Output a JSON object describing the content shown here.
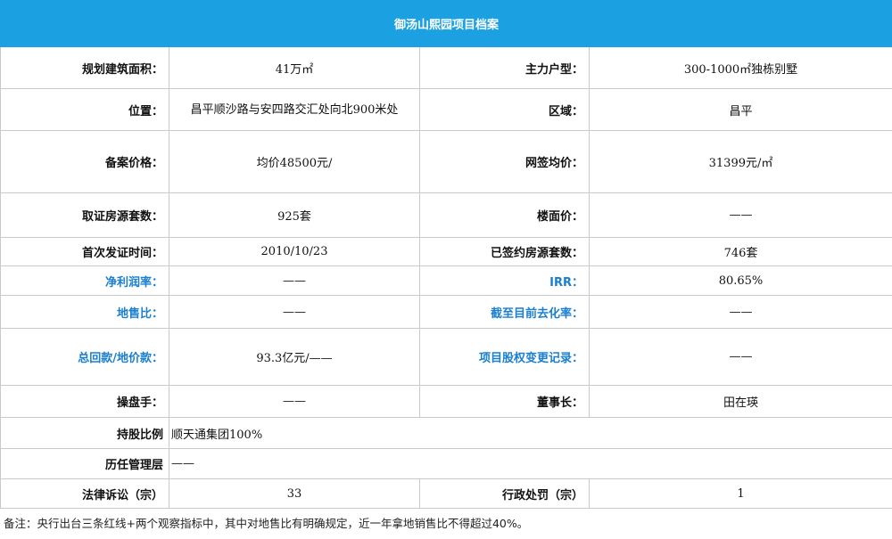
{
  "title": "御汤山熙园项目档案",
  "rows": [
    {
      "l1": "规划建筑面积：",
      "v1": "41万㎡",
      "l2": "主力户型：",
      "v2": "300-1000㎡独栋别墅"
    },
    {
      "l1": "位置：",
      "v1": "昌平顺沙路与安四路交汇处向北900米处",
      "l2": "区域：",
      "v2": "昌平"
    },
    {
      "l1": "备案价格：",
      "v1": "均价48500元/",
      "l2": "网签均价：",
      "v2": "31399元/㎡"
    },
    {
      "l1": "取证房源套数：",
      "v1": "925套",
      "l2": "楼面价：",
      "v2": "——"
    },
    {
      "l1": "首次发证时间：",
      "v1": "2010/10/23",
      "l2": "已签约房源套数：",
      "v2": "746套"
    },
    {
      "l1": "净利润率：",
      "v1": "——",
      "l2": "IRR：",
      "v2": "80.65%"
    },
    {
      "l1": "地售比：",
      "v1": "——",
      "l2": "截至目前去化率：",
      "v2": "——"
    },
    {
      "l1": "总回款/地价款：",
      "v1": "93.3亿元/——",
      "l2": "项目股权变更记录：",
      "v2": "——"
    },
    {
      "l1": "操盘手：",
      "v1": "——",
      "l2": "董事长：",
      "v2": "田在瑛"
    }
  ],
  "shareholding": {
    "label": "持股比例",
    "value": "顺天通集团100%"
  },
  "management": {
    "label": "历任管理层",
    "value": "——"
  },
  "legal": {
    "l1": "法律诉讼（宗）",
    "v1": "33",
    "l2": "行政处罚（宗）",
    "v2": "1"
  },
  "note": "备注：央行出台三条红线+两个观察指标中，其中对地售比有明确规定，近一年拿地销售比不得超过40%。",
  "colors": {
    "header_bg": "#1ba1e2",
    "blue_label": "#1a7fd0",
    "border": "#c9c9c9"
  }
}
